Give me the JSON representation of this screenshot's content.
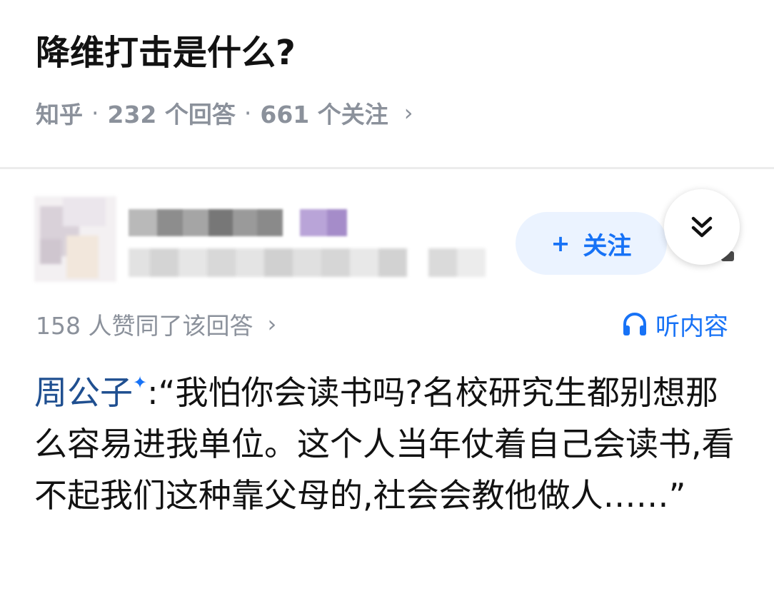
{
  "question": {
    "title": "降维打击是什么?",
    "source": "知乎",
    "separator": "·",
    "answers_count": "232 个回答",
    "followers_count": "661 个关注",
    "chevron": "›"
  },
  "author": {
    "follow_label": "关注",
    "follow_icon": "+"
  },
  "answer": {
    "upvote_text": "158 人赞同了该回答",
    "listen_label": "听内容",
    "author_link": "周公子",
    "badge": "✦",
    "colon": ":",
    "body": "“我怕你会读书吗?名校研究生都别想那么容易进我单位。这个人当年仗着自己会读书,看不起我们这种靠父母的,社会会教他做人……”"
  },
  "colors": {
    "accent": "#1772f6",
    "link": "#1f4f90",
    "meta": "#8b919b",
    "title": "#121212",
    "follow_bg": "#ebf3ff"
  },
  "icons": {
    "collapse": "double-chevron-down-icon",
    "listen": "headphones-icon"
  }
}
